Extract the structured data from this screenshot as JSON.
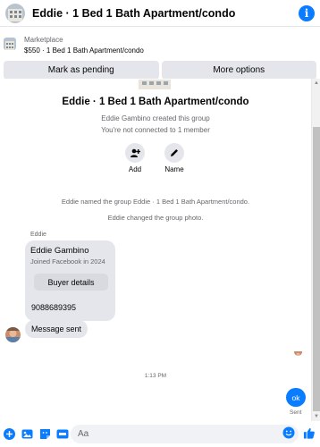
{
  "header": {
    "title": "Eddie · 1 Bed 1 Bath Apartment/condo",
    "info_glyph": "i"
  },
  "marketplace": {
    "label": "Marketplace",
    "listing": "$550 · 1 Bed 1 Bath Apartment/condo",
    "buttons": {
      "pending": "Mark as pending",
      "more": "More options"
    }
  },
  "conversation": {
    "group_name": "Eddie · 1 Bed 1 Bath Apartment/condo",
    "created_text": "Eddie Gambino created this group",
    "connected_text": "You're not connected to 1 member",
    "actions": {
      "add": "Add",
      "name": "Name"
    },
    "system_messages": [
      "Eddie named the group Eddie · 1 Bed 1 Bath Apartment/condo.",
      "Eddie changed the group photo."
    ],
    "sender_name": "Eddie",
    "profile_card": {
      "name": "Eddie Gambino",
      "joined": "Joined Facebook in 2024",
      "button": "Buyer details"
    },
    "messages": [
      "9088689395",
      "Message sent"
    ],
    "timestamp": "1:13 PM",
    "outgoing": {
      "text": "ok",
      "status": "Sent"
    }
  },
  "composer": {
    "placeholder": "Aa"
  },
  "colors": {
    "accent": "#0a7cff",
    "bubble": "#e4e6eb",
    "secondary_text": "#65676b"
  }
}
